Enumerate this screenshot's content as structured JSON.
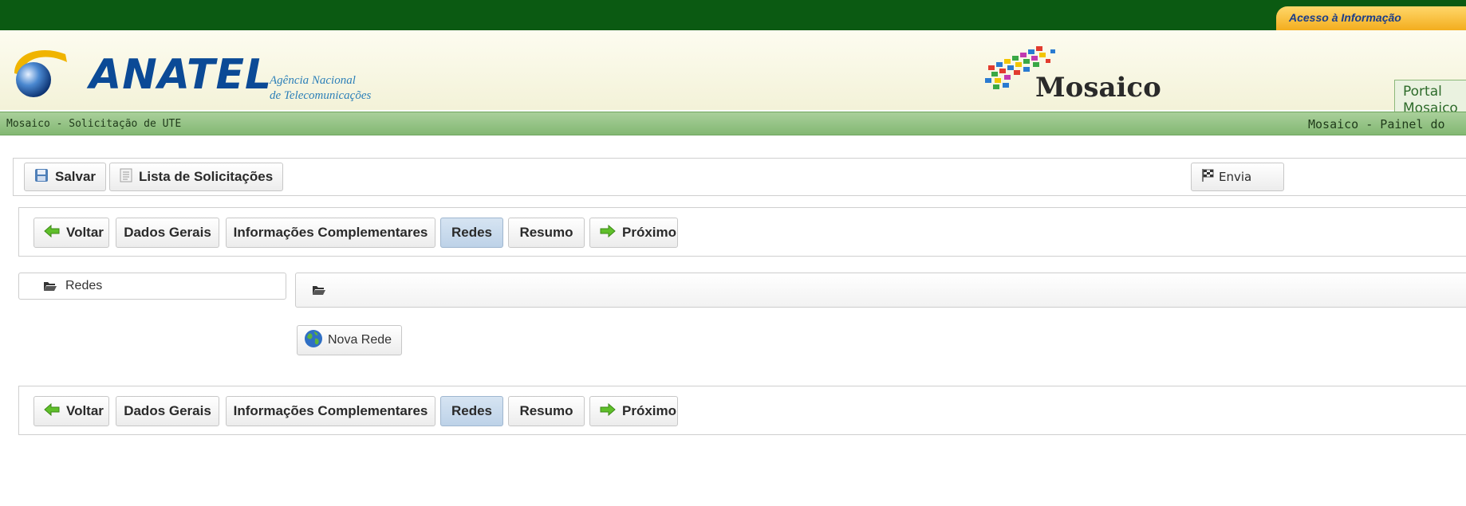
{
  "header": {
    "acesso_link": "Acesso à Informação",
    "logo_name": "ANATEL",
    "logo_sub_line1": "Agência Nacional",
    "logo_sub_line2": "de Telecomunicações",
    "mosaico_brand": "Mosaico",
    "portal_line1": "Portal",
    "portal_line2": "Mosaico",
    "brand_green": "#0b5a12",
    "brand_blue": "#0b4a96"
  },
  "subbar": {
    "left": "Mosaico - Solicitação de UTE",
    "right": "Mosaico - Painel do"
  },
  "toolbar": {
    "save_label": "Salvar",
    "list_label": "Lista de Solicitações",
    "send_label": "Envia"
  },
  "steps": {
    "back_label": "Voltar",
    "general_label": "Dados Gerais",
    "complementary_label": "Informações Complementares",
    "networks_label": "Redes",
    "summary_label": "Resumo",
    "next_label": "Próximo",
    "active_step": "Redes"
  },
  "tree": {
    "root_label": "Redes"
  },
  "actions": {
    "new_network_label": "Nova Rede"
  },
  "icons": {
    "save": "floppy-disk-icon",
    "list": "document-list-icon",
    "send": "flag-icon",
    "back": "green-arrow-left-icon",
    "next": "green-arrow-right-icon",
    "folder": "open-folder-icon",
    "globe": "globe-icon"
  }
}
